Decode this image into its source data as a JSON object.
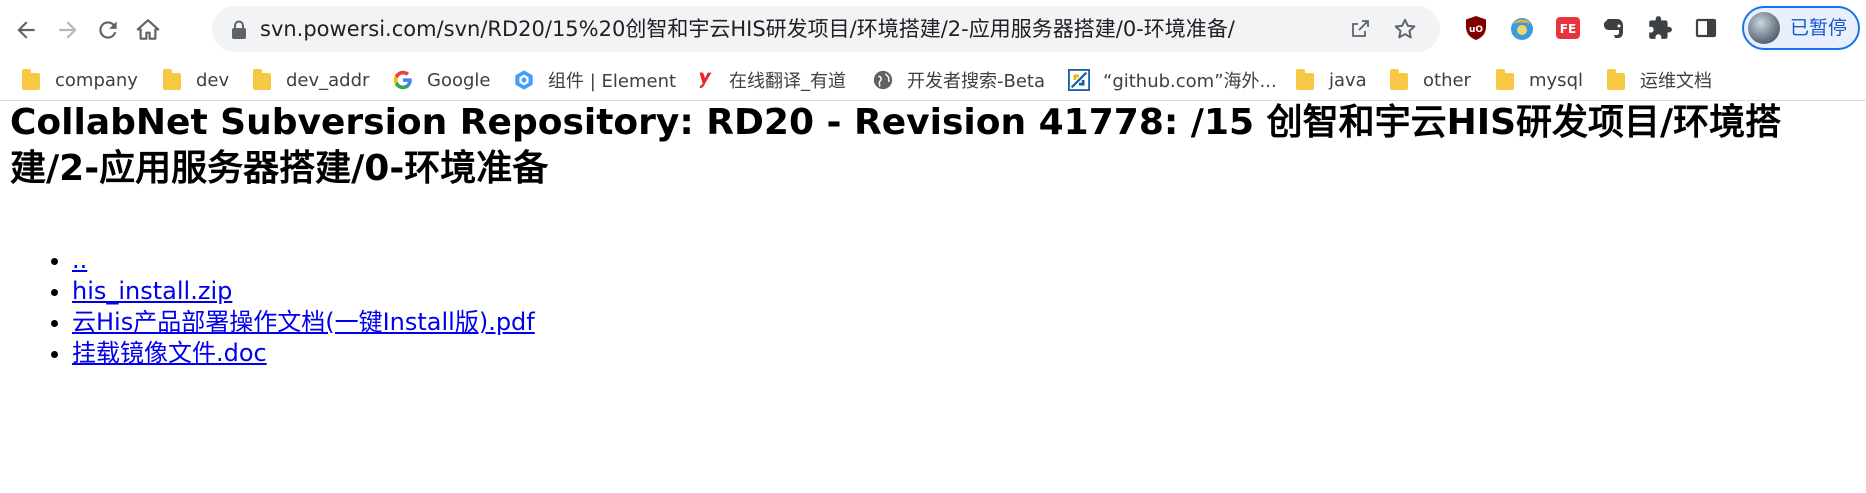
{
  "browser": {
    "url": "svn.powersi.com/svn/RD20/15%20创智和宇云HIS研发项目/环境搭建/2-应用服务器搭建/0-环境准备/",
    "profile_label": "已暂停",
    "icons": {
      "back": "arrow-left-icon",
      "forward": "arrow-right-icon",
      "reload": "reload-icon",
      "home": "home-icon",
      "lock": "lock-icon",
      "share": "share-icon",
      "star": "star-icon",
      "extensions": [
        "ublock-shield-icon",
        "ball-extension-icon",
        "fe-helper-icon",
        "evernote-icon",
        "puzzle-extensions-icon",
        "side-panel-icon"
      ]
    },
    "accent_color": "#1a73e8"
  },
  "bookmarks": [
    {
      "label": "company",
      "icon": "folder-icon"
    },
    {
      "label": "dev",
      "icon": "folder-icon"
    },
    {
      "label": "dev_addr",
      "icon": "folder-icon"
    },
    {
      "label": "Google",
      "icon": "google-icon"
    },
    {
      "label": "组件 | Element",
      "icon": "element-icon"
    },
    {
      "label": "在线翻译_有道",
      "icon": "youdao-icon"
    },
    {
      "label": "开发者搜索-Beta",
      "icon": "globe-icon"
    },
    {
      "label": "“github.com”海外...",
      "icon": "github-mirror-icon"
    },
    {
      "label": "java",
      "icon": "folder-icon"
    },
    {
      "label": "other",
      "icon": "folder-icon"
    },
    {
      "label": "mysql",
      "icon": "folder-icon"
    },
    {
      "label": "运维文档",
      "icon": "folder-icon"
    }
  ],
  "page": {
    "title": "CollabNet Subversion Repository: RD20 - Revision 41778: /15 创智和宇云HIS研发项目/环境搭建/2-应用服务器搭建/0-环境准备",
    "entries": [
      "..",
      "his_install.zip",
      "云His产品部署操作文档(一键Install版).pdf",
      "挂载镜像文件.doc"
    ],
    "link_color": "#0000ee"
  }
}
